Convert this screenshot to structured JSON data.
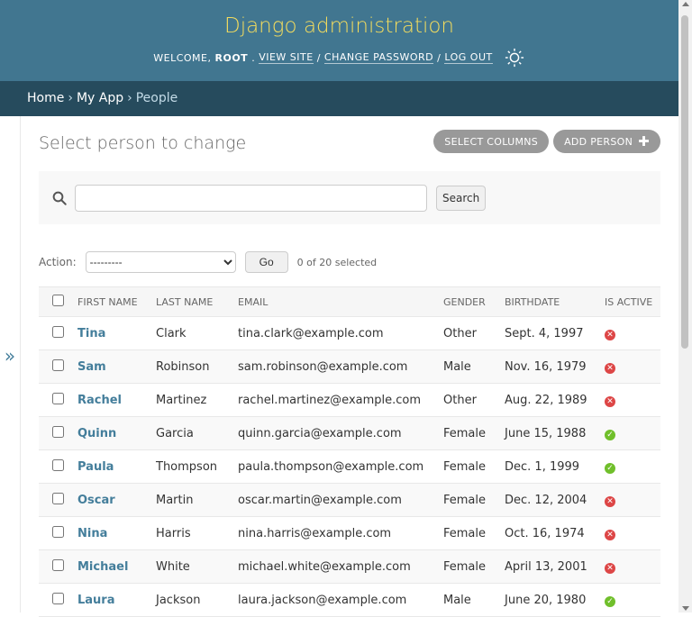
{
  "header": {
    "branding": "Django administration",
    "welcome": "WELCOME,",
    "user": "ROOT",
    "view_site": "VIEW SITE",
    "change_password": "CHANGE PASSWORD",
    "log_out": "LOG OUT",
    "sep": "/"
  },
  "breadcrumbs": [
    "Home",
    "My App",
    "People"
  ],
  "breadcrumb_sep": "›",
  "sidebar_toggle": "»",
  "page": {
    "title": "Select person to change",
    "select_columns": "SELECT COLUMNS",
    "add_person": "ADD PERSON"
  },
  "search": {
    "value": "",
    "button": "Search"
  },
  "actions": {
    "label": "Action:",
    "selected_option": "---------",
    "go": "Go",
    "counter": "0 of 20 selected"
  },
  "table": {
    "columns": [
      "FIRST NAME",
      "LAST NAME",
      "EMAIL",
      "GENDER",
      "BIRTHDATE",
      "IS ACTIVE"
    ],
    "rows": [
      {
        "first": "Tina",
        "last": "Clark",
        "email": "tina.clark@example.com",
        "gender": "Other",
        "birthdate": "Sept. 4, 1997",
        "active": false
      },
      {
        "first": "Sam",
        "last": "Robinson",
        "email": "sam.robinson@example.com",
        "gender": "Male",
        "birthdate": "Nov. 16, 1979",
        "active": false
      },
      {
        "first": "Rachel",
        "last": "Martinez",
        "email": "rachel.martinez@example.com",
        "gender": "Other",
        "birthdate": "Aug. 22, 1989",
        "active": false
      },
      {
        "first": "Quinn",
        "last": "Garcia",
        "email": "quinn.garcia@example.com",
        "gender": "Female",
        "birthdate": "June 15, 1988",
        "active": true
      },
      {
        "first": "Paula",
        "last": "Thompson",
        "email": "paula.thompson@example.com",
        "gender": "Female",
        "birthdate": "Dec. 1, 1999",
        "active": true
      },
      {
        "first": "Oscar",
        "last": "Martin",
        "email": "oscar.martin@example.com",
        "gender": "Female",
        "birthdate": "Dec. 12, 2004",
        "active": false
      },
      {
        "first": "Nina",
        "last": "Harris",
        "email": "nina.harris@example.com",
        "gender": "Female",
        "birthdate": "Oct. 16, 1974",
        "active": false
      },
      {
        "first": "Michael",
        "last": "White",
        "email": "michael.white@example.com",
        "gender": "Female",
        "birthdate": "April 13, 2001",
        "active": false
      },
      {
        "first": "Laura",
        "last": "Jackson",
        "email": "laura.jackson@example.com",
        "gender": "Male",
        "birthdate": "June 20, 1980",
        "active": true
      }
    ]
  },
  "colors": {
    "header_bg": "#417690",
    "branding": "#f5dd5d",
    "breadcrumbs_bg": "#264b5d",
    "link": "#447e9b",
    "active_yes": "#70bf2b",
    "active_no": "#dd4646"
  },
  "icons": {
    "theme": "sun-icon",
    "search": "search-icon",
    "add": "plus-icon",
    "active_yes": "check-icon",
    "active_no": "x-icon"
  }
}
